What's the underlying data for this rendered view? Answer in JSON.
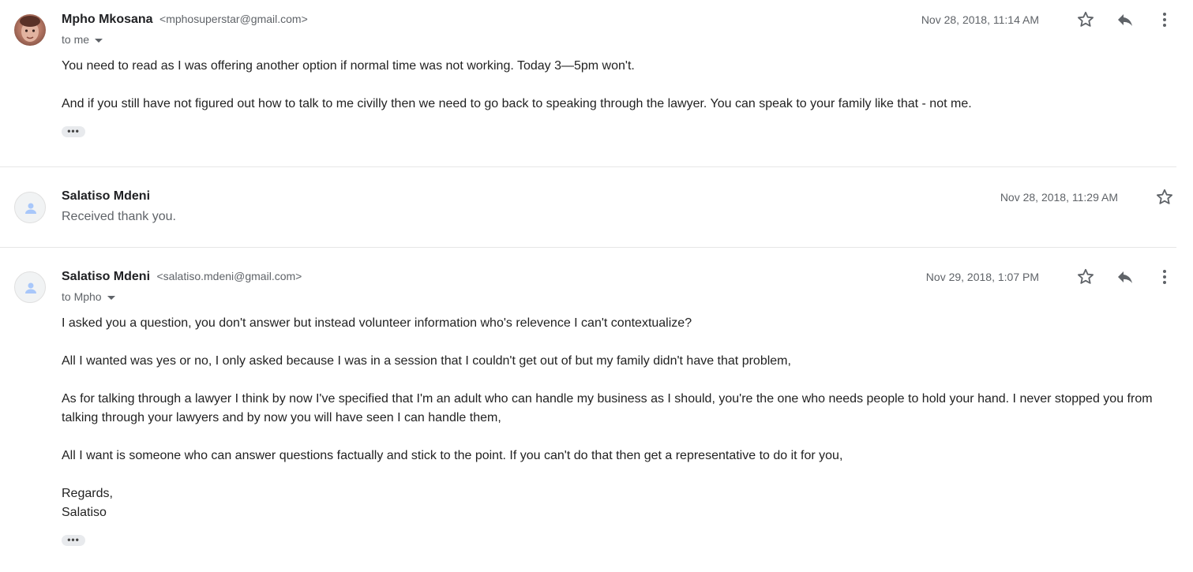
{
  "messages": [
    {
      "sender_name": "Mpho Mkosana",
      "sender_email": "<mphosuperstar@gmail.com>",
      "to": "to me",
      "date": "Nov 28, 2018, 11:14 AM",
      "avatar": "photo-avatar",
      "paragraphs": [
        "You need to read as I was offering another option if normal time was not working. Today 3—5pm won't.",
        "And if you still have not figured out how to talk to me civilly then we need to go back to speaking through the lawyer. You can speak to your family like that - not me."
      ],
      "ellipsis": "•••"
    },
    {
      "sender_name": "Salatiso Mdeni",
      "snippet": "Received thank you.",
      "date": "Nov 28, 2018, 11:29 AM",
      "avatar": "person-icon"
    },
    {
      "sender_name": "Salatiso Mdeni",
      "sender_email": "<salatiso.mdeni@gmail.com>",
      "to": "to Mpho",
      "date": "Nov 29, 2018, 1:07 PM",
      "avatar": "person-icon",
      "paragraphs": [
        "I asked you a question, you don't answer but instead volunteer information who's relevence I can't contextualize?",
        "All I wanted was yes or no, I only asked because I was in a session that I couldn't get out of but my family didn't have that problem,",
        "As for talking through a lawyer I think by now I've specified that I'm an adult who can handle my business as I should, you're the one who needs people to hold your hand. I never stopped you from talking through your lawyers and by now you will have seen I can handle them,",
        "All I want is someone who can answer questions factually and stick to the point. If you can't do that then get a representative to do it for you,",
        "Regards,",
        "Salatiso"
      ],
      "ellipsis": "•••"
    }
  ],
  "icons": {
    "star": "star-icon",
    "reply": "reply-icon",
    "more": "more-vert-icon",
    "caret": "chevron-down-icon"
  },
  "colors": {
    "text": "#222222",
    "muted": "#5f6368",
    "divider": "#e6e6e6",
    "avatar_placeholder": "#a8c7fa"
  }
}
